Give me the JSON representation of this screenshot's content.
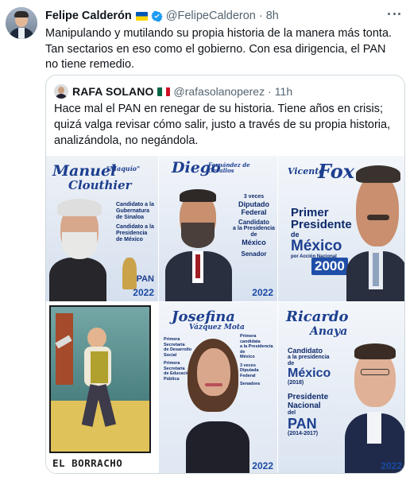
{
  "author": {
    "name": "Felipe Calderón",
    "handle": "@FelipeCalderon",
    "separator": "·",
    "time": "8h"
  },
  "tweet_text": "Manipulando y mutilando su propia historia de la manera más tonta. Tan sectarios en eso como el gobierno. Con esa dirigencia, el PAN no tiene remedio.",
  "quoted": {
    "name": "RAFA SOLANO",
    "handle": "@rafasolanoperez",
    "separator": "·",
    "time": "11h",
    "text": "Hace mal el PAN en renegar de su historia. Tiene años en crisis; quizá valga revisar cómo salir, justo a través de su propia historia, analizándola, no negándola."
  },
  "images": [
    {
      "name_script": "Manuel",
      "name_script2": "Clouthier",
      "nickname": "\"Maquío\"",
      "lines": [
        "Candidato a la",
        "Gubernatura",
        "de Sinaloa",
        "Candidato a la",
        "Presidencia",
        "de México"
      ],
      "mark": "2022",
      "corner": "PAN"
    },
    {
      "name_script": "Diego",
      "name_script2": "Fernández de Cevallos",
      "lines": [
        "3 veces",
        "Diputado",
        "Federal",
        "Candidato",
        "a la Presidencia de",
        "México",
        "Senador"
      ],
      "mark": "2022"
    },
    {
      "name_script": "Vicente",
      "name_big": "Fox",
      "lines": [
        "Primer",
        "Presidente",
        "de",
        "México",
        "por Acción Nacional",
        "2000"
      ],
      "mark": ""
    },
    {
      "caption": "EL BORRACHO"
    },
    {
      "name_script": "Josefina",
      "name_script2": "Vázquez Mota",
      "lines": [
        "Primera",
        "Secretaria",
        "de Desarrollo",
        "Social",
        "Primera",
        "Secretaria",
        "de Educación",
        "Pública",
        "Primera",
        "candidata",
        "a la Presidencia de",
        "México",
        "3 veces",
        "Diputada",
        "Federal",
        "Senadora"
      ],
      "mark": "2022"
    },
    {
      "name_script": "Ricardo",
      "name_script2": "Anaya",
      "lines": [
        "Candidato",
        "a la presidencia",
        "de",
        "México",
        "(2018)",
        "Presidente",
        "Nacional",
        "del",
        "PAN",
        "(2014-2017)"
      ],
      "mark": "2022"
    }
  ],
  "colors": {
    "text": "#0f1419",
    "secondary": "#536471",
    "border": "#cfd9de",
    "verified": "#1d9bf0",
    "poster_blue": "#1d3f8f"
  },
  "icons": [
    "verified-badge-icon",
    "ukraine-flag-icon",
    "mexico-flag-icon",
    "more-options-icon"
  ]
}
